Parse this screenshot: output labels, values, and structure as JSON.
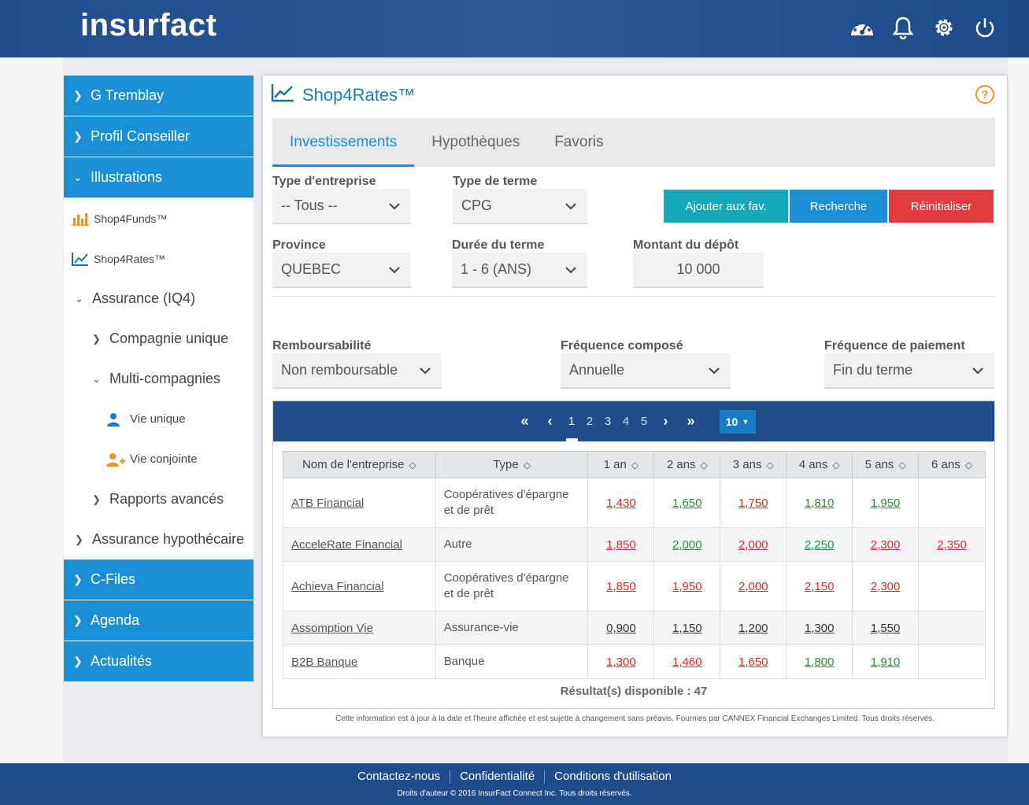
{
  "header": {
    "logo": "insurfact",
    "icons": [
      "dashboard-icon",
      "bell-icon",
      "gear-icon",
      "power-icon"
    ]
  },
  "sidebar": {
    "items": [
      {
        "label": "G Tremblay",
        "style": "blue"
      },
      {
        "label": "Profil Conseiller",
        "style": "blue"
      },
      {
        "label": "Illustrations",
        "style": "blue",
        "expanded": true
      },
      {
        "label": "Shop4Funds™",
        "icon": "bar-chart-icon"
      },
      {
        "label": "Shop4Rates™",
        "icon": "line-chart-icon"
      },
      {
        "label": "Assurance (IQ4)",
        "expanded": true
      },
      {
        "label": "Compagnie unique"
      },
      {
        "label": "Multi-compagnies",
        "expanded": true
      },
      {
        "label": "Vie unique",
        "icon": "user-icon"
      },
      {
        "label": "Vie conjointe",
        "icon": "user-plus-icon"
      },
      {
        "label": "Rapports avancés"
      },
      {
        "label": "Assurance hypothécaire"
      },
      {
        "label": "C-Files",
        "style": "blue"
      },
      {
        "label": "Agenda",
        "style": "blue"
      },
      {
        "label": "Actualités",
        "style": "blue"
      }
    ]
  },
  "panel": {
    "title": "Shop4Rates™",
    "help": "?",
    "tabs": [
      "Investissements",
      "Hypothèques",
      "Favoris"
    ],
    "active_tab": "Investissements"
  },
  "form": {
    "type_entreprise": {
      "label": "Type d'entreprise",
      "value": "-- Tous --"
    },
    "type_terme": {
      "label": "Type de terme",
      "value": "CPG"
    },
    "province": {
      "label": "Province",
      "value": "QUEBEC"
    },
    "duree_terme": {
      "label": "Durée du terme",
      "value": "1 - 6 (ANS)"
    },
    "montant_depot": {
      "label": "Montant du dépôt",
      "value": "10 000"
    },
    "remboursabilite": {
      "label": "Remboursabilité",
      "value": "Non remboursable"
    },
    "frequence_compose": {
      "label": "Fréquence composé",
      "value": "Annuelle"
    },
    "frequence_paiement": {
      "label": "Fréquence de paiement",
      "value": "Fin du terme"
    }
  },
  "buttons": {
    "ajouter": "Ajouter aux fav.",
    "recherche": "Recherche",
    "reinitialiser": "Réinitialiser"
  },
  "colors": {
    "teal": "#12aab8",
    "blue": "#1a8fd6",
    "red": "#e23b3b",
    "navy": "#1f4d8c"
  },
  "pagination": {
    "pages": [
      "1",
      "2",
      "3",
      "4",
      "5"
    ],
    "current": "1",
    "per_page": "10"
  },
  "table": {
    "headers": [
      "Nom de l'entreprise",
      "Type",
      "1 an",
      "2 ans",
      "3 ans",
      "4 ans",
      "5 ans",
      "6 ans"
    ],
    "rows": [
      {
        "name": "ATB Financial",
        "type": "Coopératives d'épargne et de prêt",
        "rates": [
          {
            "v": "1,430",
            "c": "red"
          },
          {
            "v": "1,650",
            "c": "green"
          },
          {
            "v": "1,750",
            "c": "red"
          },
          {
            "v": "1,810",
            "c": "green"
          },
          {
            "v": "1,950",
            "c": "green"
          },
          {
            "v": "",
            "c": ""
          }
        ]
      },
      {
        "name": "AcceleRate Financial",
        "type": "Autre",
        "rates": [
          {
            "v": "1,850",
            "c": "red"
          },
          {
            "v": "2,000",
            "c": "green"
          },
          {
            "v": "2,000",
            "c": "red"
          },
          {
            "v": "2,250",
            "c": "green"
          },
          {
            "v": "2,300",
            "c": "red"
          },
          {
            "v": "2,350",
            "c": "red"
          }
        ]
      },
      {
        "name": "Achieva Financial",
        "type": "Coopératives d'épargne et de prêt",
        "rates": [
          {
            "v": "1,850",
            "c": "red"
          },
          {
            "v": "1,950",
            "c": "red"
          },
          {
            "v": "2,000",
            "c": "red"
          },
          {
            "v": "2,150",
            "c": "red"
          },
          {
            "v": "2,300",
            "c": "red"
          },
          {
            "v": "",
            "c": ""
          }
        ]
      },
      {
        "name": "Assomption Vie",
        "type": "Assurance-vie",
        "rates": [
          {
            "v": "0,900",
            "c": "dark"
          },
          {
            "v": "1,150",
            "c": "dark"
          },
          {
            "v": "1,200",
            "c": "dark"
          },
          {
            "v": "1,300",
            "c": "dark"
          },
          {
            "v": "1,550",
            "c": "dark"
          },
          {
            "v": "",
            "c": ""
          }
        ]
      },
      {
        "name": "B2B Banque",
        "type": "Banque",
        "rates": [
          {
            "v": "1,300",
            "c": "red"
          },
          {
            "v": "1,460",
            "c": "red"
          },
          {
            "v": "1,650",
            "c": "red"
          },
          {
            "v": "1,800",
            "c": "green"
          },
          {
            "v": "1,910",
            "c": "green"
          },
          {
            "v": "",
            "c": ""
          }
        ]
      }
    ],
    "result_count": "Résultat(s) disponible : 47"
  },
  "disclaimer": "Cette information est à jour à la date et l'heure affichée et est sujette à changement sans préavis. Fournies par CANNEX Financial Exchanges Limited. Tous droits réservés.",
  "footer": {
    "links": [
      "Contactez-nous",
      "Confidentialité",
      "Conditions d'utilisation"
    ],
    "copyright": "Droits d'auteur © 2016 InsurFact Connect Inc. Tous droits réservés."
  }
}
